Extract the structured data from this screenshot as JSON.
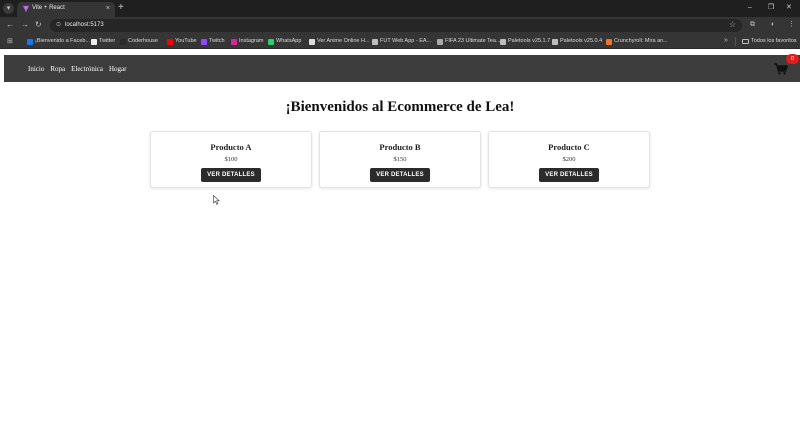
{
  "browser": {
    "tab_title": "Vite + React",
    "tab_close": "×",
    "new_tab": "+",
    "url": "localhost:5173",
    "window_controls": {
      "minimize": "–",
      "maximize": "❐",
      "close": "✕"
    },
    "nav": {
      "back": "←",
      "forward": "→",
      "reload": "↻"
    },
    "bookmarks": [
      {
        "label": "¡Bienvenido a Faceb...",
        "icon": "facebook-icon",
        "color": "#1877f2"
      },
      {
        "label": "Twitter",
        "icon": "x-icon",
        "color": "#eeeeee"
      },
      {
        "label": "Coderhouse",
        "icon": "coderhouse-icon",
        "color": "#2a2a2a"
      },
      {
        "label": "YouTube",
        "icon": "youtube-icon",
        "color": "#ff0000"
      },
      {
        "label": "Twitch",
        "icon": "twitch-icon",
        "color": "#9146ff"
      },
      {
        "label": "Instagram",
        "icon": "instagram-icon",
        "color": "#d6249f"
      },
      {
        "label": "WhatsApp",
        "icon": "whatsapp-icon",
        "color": "#25d366"
      },
      {
        "label": "Ver Anime Online H...",
        "icon": "anime-icon",
        "color": "#dddddd"
      },
      {
        "label": "FUT Web App - EA...",
        "icon": "globe-icon",
        "color": "#bdbdbd"
      },
      {
        "label": "FIFA 23 Ultimate Tea...",
        "icon": "fifa-icon",
        "color": "#aaaaaa"
      },
      {
        "label": "Paletools v25.1.7",
        "icon": "globe-icon",
        "color": "#bdbdbd"
      },
      {
        "label": "Paletools v25.0.4",
        "icon": "globe-icon",
        "color": "#bdbdbd"
      },
      {
        "label": "Crunchyroll: Mira an...",
        "icon": "crunchyroll-icon",
        "color": "#f47521"
      }
    ],
    "bookmarks_more": "»",
    "all_bookmarks": "Todos los favoritos"
  },
  "page": {
    "nav_links": [
      "Inicio",
      "Ropa",
      "Electrónica",
      "Hogar"
    ],
    "cart_count": "0",
    "title": "¡Bienvenidos al Ecommerce de Lea!",
    "products": [
      {
        "name": "Producto A",
        "price": "$100",
        "button": "VER DETALLES"
      },
      {
        "name": "Producto B",
        "price": "$150",
        "button": "VER DETALLES"
      },
      {
        "name": "Producto C",
        "price": "$200",
        "button": "VER DETALLES"
      }
    ]
  },
  "colors": {
    "navbar": "#3d3d3d",
    "button": "#2b2b2b",
    "badge": "#e01e1e"
  }
}
